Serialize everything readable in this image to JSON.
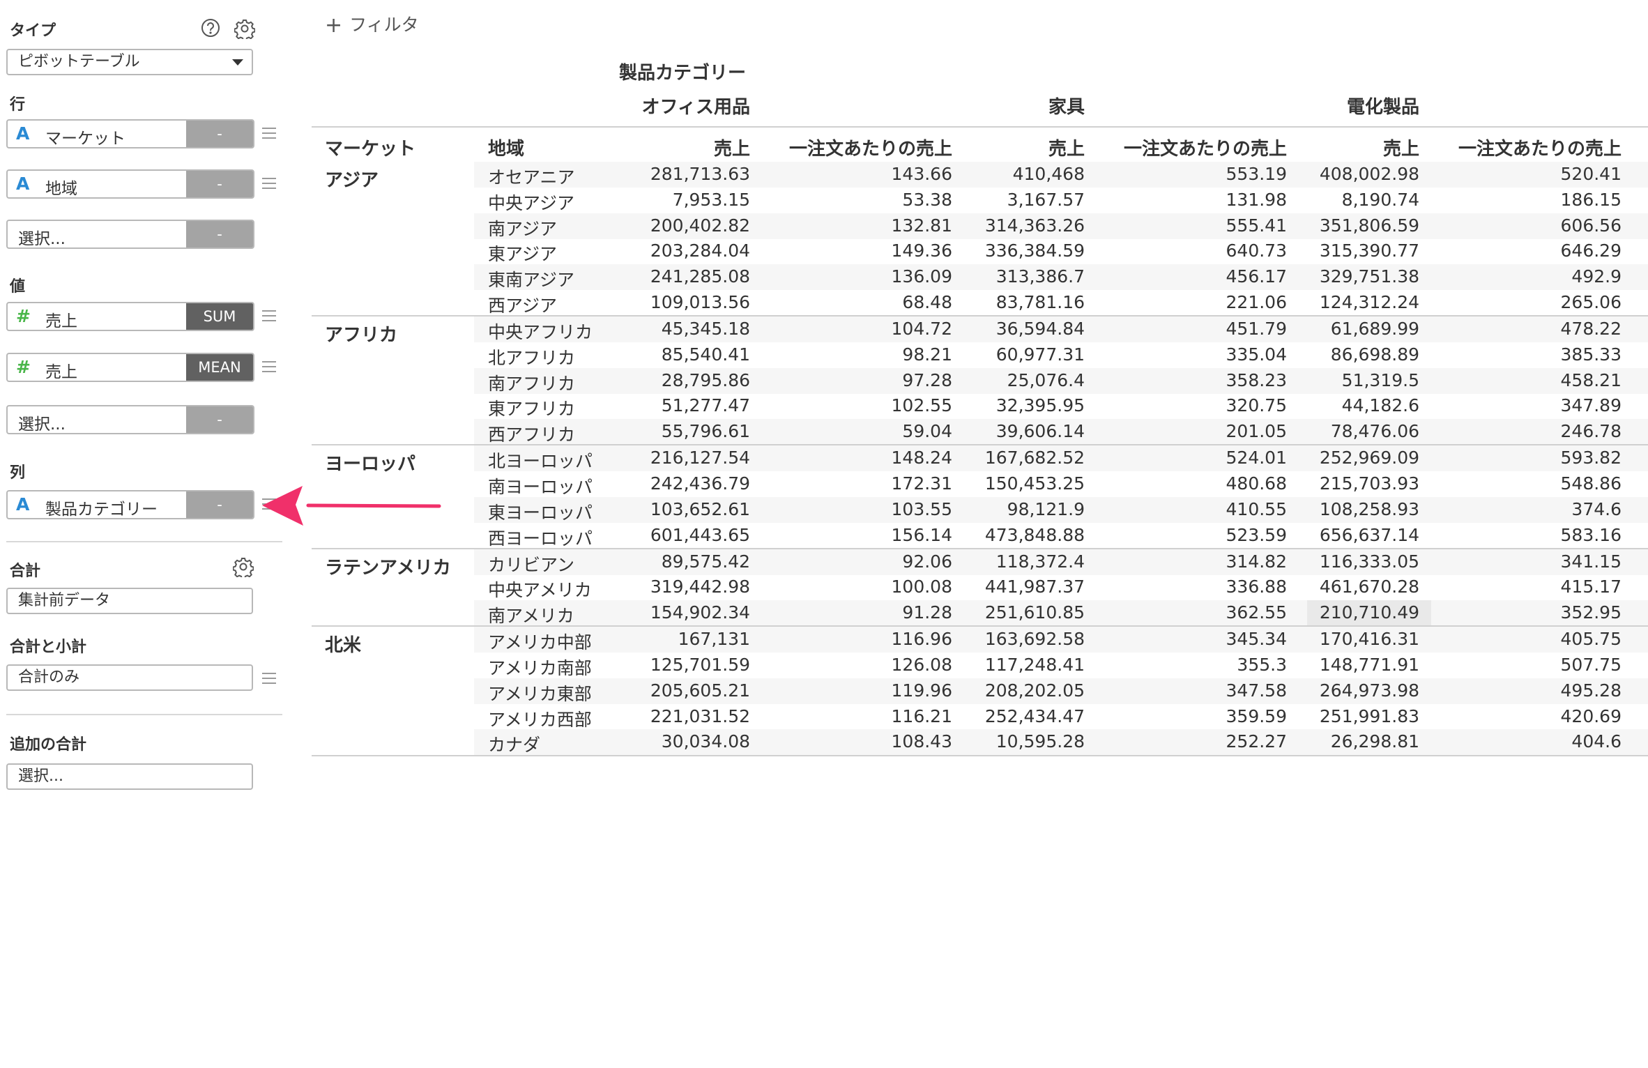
{
  "sidebar": {
    "type_label": "タイプ",
    "type_value": "ピボットテーブル",
    "rows_label": "行",
    "rows": [
      {
        "glyph": "A",
        "label": "マーケット",
        "agg": "-"
      },
      {
        "glyph": "A",
        "label": "地域",
        "agg": "-"
      },
      {
        "glyph": "",
        "label": "選択...",
        "agg": "-"
      }
    ],
    "values_label": "値",
    "values": [
      {
        "glyph": "#",
        "label": "売上",
        "agg": "SUM"
      },
      {
        "glyph": "#",
        "label": "売上",
        "agg": "MEAN"
      },
      {
        "glyph": "",
        "label": "選択...",
        "agg": "-"
      }
    ],
    "columns_label": "列",
    "columns": [
      {
        "glyph": "A",
        "label": "製品カテゴリー",
        "agg": "-"
      }
    ],
    "total_label": "合計",
    "total_value": "集計前データ",
    "subtotal_label": "合計と小計",
    "subtotal_value": "合計のみ",
    "extra_total_label": "追加の合計",
    "extra_total_value": "選択...",
    "arrow_color": "#f0306a"
  },
  "filter": {
    "icon": "plus-icon",
    "label": "フィルタ"
  },
  "pivot": {
    "column_field": "製品カテゴリー",
    "categories": [
      "オフィス用品",
      "家具",
      "電化製品"
    ],
    "row_headers": [
      "マーケット",
      "地域"
    ],
    "measures": [
      "売上",
      "一注文あたりの売上"
    ],
    "groups": [
      {
        "market": "アジア",
        "rows": [
          {
            "region": "オセアニア",
            "v": [
              "281,713.63",
              "143.66",
              "410,468",
              "553.19",
              "408,002.98",
              "520.41"
            ]
          },
          {
            "region": "中央アジア",
            "v": [
              "7,953.15",
              "53.38",
              "3,167.57",
              "131.98",
              "8,190.74",
              "186.15"
            ]
          },
          {
            "region": "南アジア",
            "v": [
              "200,402.82",
              "132.81",
              "314,363.26",
              "555.41",
              "351,806.59",
              "606.56"
            ]
          },
          {
            "region": "東アジア",
            "v": [
              "203,284.04",
              "149.36",
              "336,384.59",
              "640.73",
              "315,390.77",
              "646.29"
            ]
          },
          {
            "region": "東南アジア",
            "v": [
              "241,285.08",
              "136.09",
              "313,386.7",
              "456.17",
              "329,751.38",
              "492.9"
            ]
          },
          {
            "region": "西アジア",
            "v": [
              "109,013.56",
              "68.48",
              "83,781.16",
              "221.06",
              "124,312.24",
              "265.06"
            ]
          }
        ]
      },
      {
        "market": "アフリカ",
        "rows": [
          {
            "region": "中央アフリカ",
            "v": [
              "45,345.18",
              "104.72",
              "36,594.84",
              "451.79",
              "61,689.99",
              "478.22"
            ]
          },
          {
            "region": "北アフリカ",
            "v": [
              "85,540.41",
              "98.21",
              "60,977.31",
              "335.04",
              "86,698.89",
              "385.33"
            ]
          },
          {
            "region": "南アフリカ",
            "v": [
              "28,795.86",
              "97.28",
              "25,076.4",
              "358.23",
              "51,319.5",
              "458.21"
            ]
          },
          {
            "region": "東アフリカ",
            "v": [
              "51,277.47",
              "102.55",
              "32,395.95",
              "320.75",
              "44,182.6",
              "347.89"
            ]
          },
          {
            "region": "西アフリカ",
            "v": [
              "55,796.61",
              "59.04",
              "39,606.14",
              "201.05",
              "78,476.06",
              "246.78"
            ]
          }
        ]
      },
      {
        "market": "ヨーロッパ",
        "rows": [
          {
            "region": "北ヨーロッパ",
            "v": [
              "216,127.54",
              "148.24",
              "167,682.52",
              "524.01",
              "252,969.09",
              "593.82"
            ]
          },
          {
            "region": "南ヨーロッパ",
            "v": [
              "242,436.79",
              "172.31",
              "150,453.25",
              "480.68",
              "215,703.93",
              "548.86"
            ]
          },
          {
            "region": "東ヨーロッパ",
            "v": [
              "103,652.61",
              "103.55",
              "98,121.9",
              "410.55",
              "108,258.93",
              "374.6"
            ]
          },
          {
            "region": "西ヨーロッパ",
            "v": [
              "601,443.65",
              "156.14",
              "473,848.88",
              "523.59",
              "656,637.14",
              "583.16"
            ]
          }
        ]
      },
      {
        "market": "ラテンアメリカ",
        "rows": [
          {
            "region": "カリビアン",
            "v": [
              "89,575.42",
              "92.06",
              "118,372.4",
              "314.82",
              "116,333.05",
              "341.15"
            ]
          },
          {
            "region": "中央アメリカ",
            "v": [
              "319,442.98",
              "100.08",
              "441,987.37",
              "336.88",
              "461,670.28",
              "415.17"
            ]
          },
          {
            "region": "南アメリカ",
            "v": [
              "154,902.34",
              "91.28",
              "251,610.85",
              "362.55",
              "210,710.49",
              "352.95"
            ],
            "highlight": 4
          }
        ]
      },
      {
        "market": "北米",
        "rows": [
          {
            "region": "アメリカ中部",
            "v": [
              "167,131",
              "116.96",
              "163,692.58",
              "345.34",
              "170,416.31",
              "405.75"
            ]
          },
          {
            "region": "アメリカ南部",
            "v": [
              "125,701.59",
              "126.08",
              "117,248.41",
              "355.3",
              "148,771.91",
              "507.75"
            ]
          },
          {
            "region": "アメリカ東部",
            "v": [
              "205,605.21",
              "119.96",
              "208,202.05",
              "347.58",
              "264,973.98",
              "495.28"
            ]
          },
          {
            "region": "アメリカ西部",
            "v": [
              "221,031.52",
              "116.21",
              "252,434.47",
              "359.59",
              "251,991.83",
              "420.69"
            ]
          },
          {
            "region": "カナダ",
            "v": [
              "30,034.08",
              "108.43",
              "10,595.28",
              "252.27",
              "26,298.81",
              "404.6"
            ]
          }
        ]
      }
    ]
  }
}
